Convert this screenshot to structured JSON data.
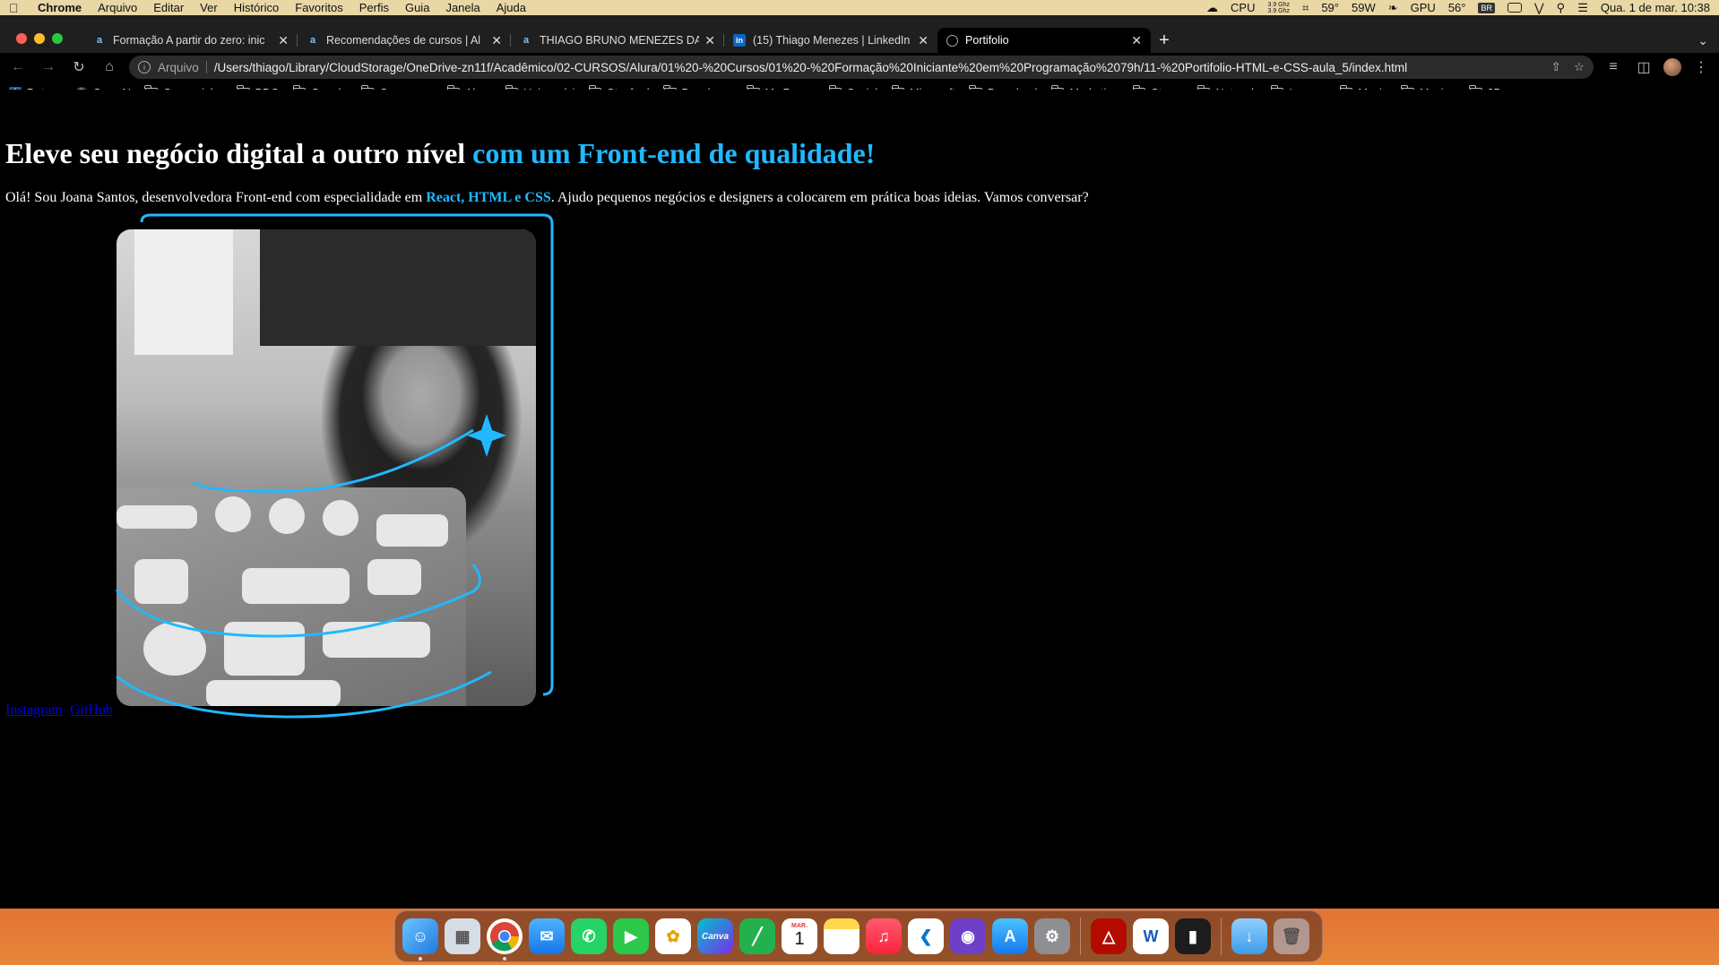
{
  "menubar": {
    "app_name": "Chrome",
    "items": [
      "Arquivo",
      "Editar",
      "Ver",
      "Histórico",
      "Favoritos",
      "Perfis",
      "Guia",
      "Janela",
      "Ajuda"
    ],
    "status": {
      "cpu_label": "CPU",
      "cpu_freq_top": "3.9 Ghz",
      "cpu_freq_bottom": "3.9 Ghz",
      "cpu_temp": "59°",
      "power": "59W",
      "gpu_label": "GPU",
      "gpu_temp": "56°",
      "keyboard": "BR",
      "datetime": "Qua. 1 de mar.  10:38"
    }
  },
  "browser": {
    "tabs": [
      {
        "title": "Formação A partir do zero: inic",
        "icon": "alura-icon",
        "active": false
      },
      {
        "title": "Recomendações de cursos | Al",
        "icon": "alura-icon",
        "active": false
      },
      {
        "title": "THIAGO BRUNO MENEZES DA",
        "icon": "alura-icon",
        "active": false
      },
      {
        "title": "(15) Thiago Menezes | LinkedIn",
        "icon": "linkedin-icon",
        "active": false
      },
      {
        "title": "Portifolio",
        "icon": "globe-icon",
        "active": true
      }
    ],
    "address": {
      "scheme_label": "Arquivo",
      "url": "/Users/thiago/Library/CloudStorage/OneDrive-zn11f/Acadêmico/02-CURSOS/Alura/01%20-%20Cursos/01%20-%20Formação%20Iniciante%20em%20Programação%2079h/11-%20Portifolio-HTML-e-CSS-aula_5/index.html"
    },
    "bookmarks": [
      {
        "label": "Detran",
        "type": "site"
      },
      {
        "label": "OpenAI",
        "type": "site"
      },
      {
        "label": "Cavaquinho",
        "type": "folder"
      },
      {
        "label": "BDC",
        "type": "folder"
      },
      {
        "label": "Google",
        "type": "folder"
      },
      {
        "label": "Concursos",
        "type": "folder"
      },
      {
        "label": "Alura",
        "type": "folder"
      },
      {
        "label": "Uniasselvi",
        "type": "folder"
      },
      {
        "label": "Stanford",
        "type": "folder"
      },
      {
        "label": "Developer",
        "type": "folder"
      },
      {
        "label": "My Pages",
        "type": "folder"
      },
      {
        "label": "Social",
        "type": "folder"
      },
      {
        "label": "Microsoft",
        "type": "folder"
      },
      {
        "label": "Download",
        "type": "folder"
      },
      {
        "label": "Marketing",
        "type": "folder"
      },
      {
        "label": "Steam",
        "type": "folder"
      },
      {
        "label": "Network",
        "type": "folder"
      },
      {
        "label": "Images",
        "type": "folder"
      },
      {
        "label": "Music",
        "type": "folder"
      },
      {
        "label": "Movies",
        "type": "folder"
      },
      {
        "label": "3D",
        "type": "folder"
      }
    ]
  },
  "page": {
    "heading_main": "Eleve seu negócio digital a outro nível ",
    "heading_accent": "com um Front-end de qualidade!",
    "intro_before": "Olá! Sou Joana Santos, desenvolvedora Front-end com especialidade em ",
    "intro_strong": "React, HTML e CSS",
    "intro_after": ". Ajudo pequenos negócios e designers a colocarem em prática boas ideias. Vamos conversar?",
    "links": [
      "Instagram",
      "GitHub"
    ],
    "accent_color": "#22b8ff"
  },
  "dock": {
    "apps": [
      "Finder",
      "Launchpad",
      "Chrome",
      "Mail",
      "WhatsApp",
      "FaceTime",
      "Photos",
      "Canva",
      "Numbers",
      "Calendar",
      "Notes",
      "Music",
      "VS Code",
      "GitHub Desktop",
      "App Store",
      "System Settings",
      "Acrobat",
      "Word",
      "Activity Monitor",
      "Downloads",
      "Trash"
    ],
    "calendar_month": "MAR.",
    "calendar_day": "1",
    "canva_label": "Canva",
    "word_label": "W"
  }
}
